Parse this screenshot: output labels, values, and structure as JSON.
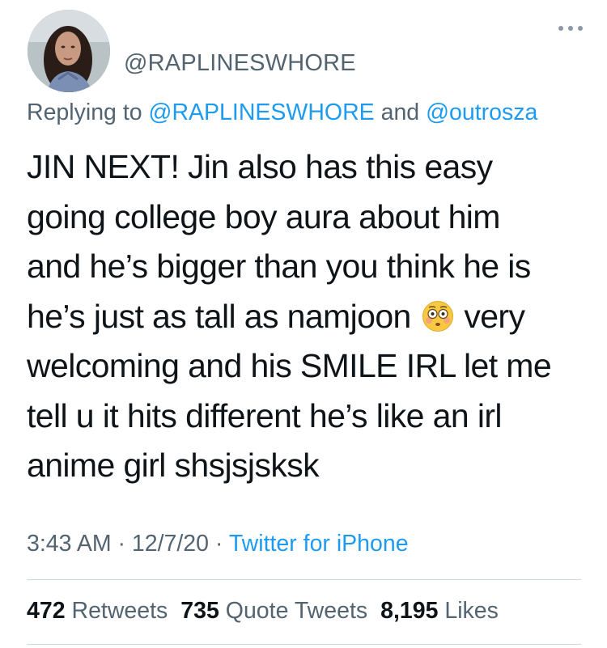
{
  "author": {
    "handle": "@RAPLINESWHORE"
  },
  "reply": {
    "prefix": "Replying to ",
    "mention1": "@RAPLINESWHORE",
    "conjunction": " and ",
    "mention2": "@outrosza"
  },
  "tweet": {
    "text_before_emoji": "JIN NEXT! Jin also has this easy\ngoing college boy aura about him\nand he’s bigger than you think he is\nhe’s just as tall as namjoon",
    "emoji_icon": "flushed-face-icon",
    "text_after_emoji": "very\nwelcoming and his SMILE IRL let me\ntell u it hits different he’s like an irl\nanime girl shsjsjsksk"
  },
  "meta": {
    "time": "3:43 AM",
    "separator1": " · ",
    "date": "12/7/20",
    "separator2": " · ",
    "source": "Twitter for iPhone"
  },
  "stats": {
    "retweets_count": "472",
    "retweets_label": "Retweets",
    "quotes_count": "735",
    "quotes_label": "Quote Tweets",
    "likes_count": "8,195",
    "likes_label": "Likes"
  },
  "colors": {
    "link": "#1d9bf0",
    "secondary_text": "#536471",
    "primary_text": "#0f1419",
    "divider": "#cfd9de"
  }
}
